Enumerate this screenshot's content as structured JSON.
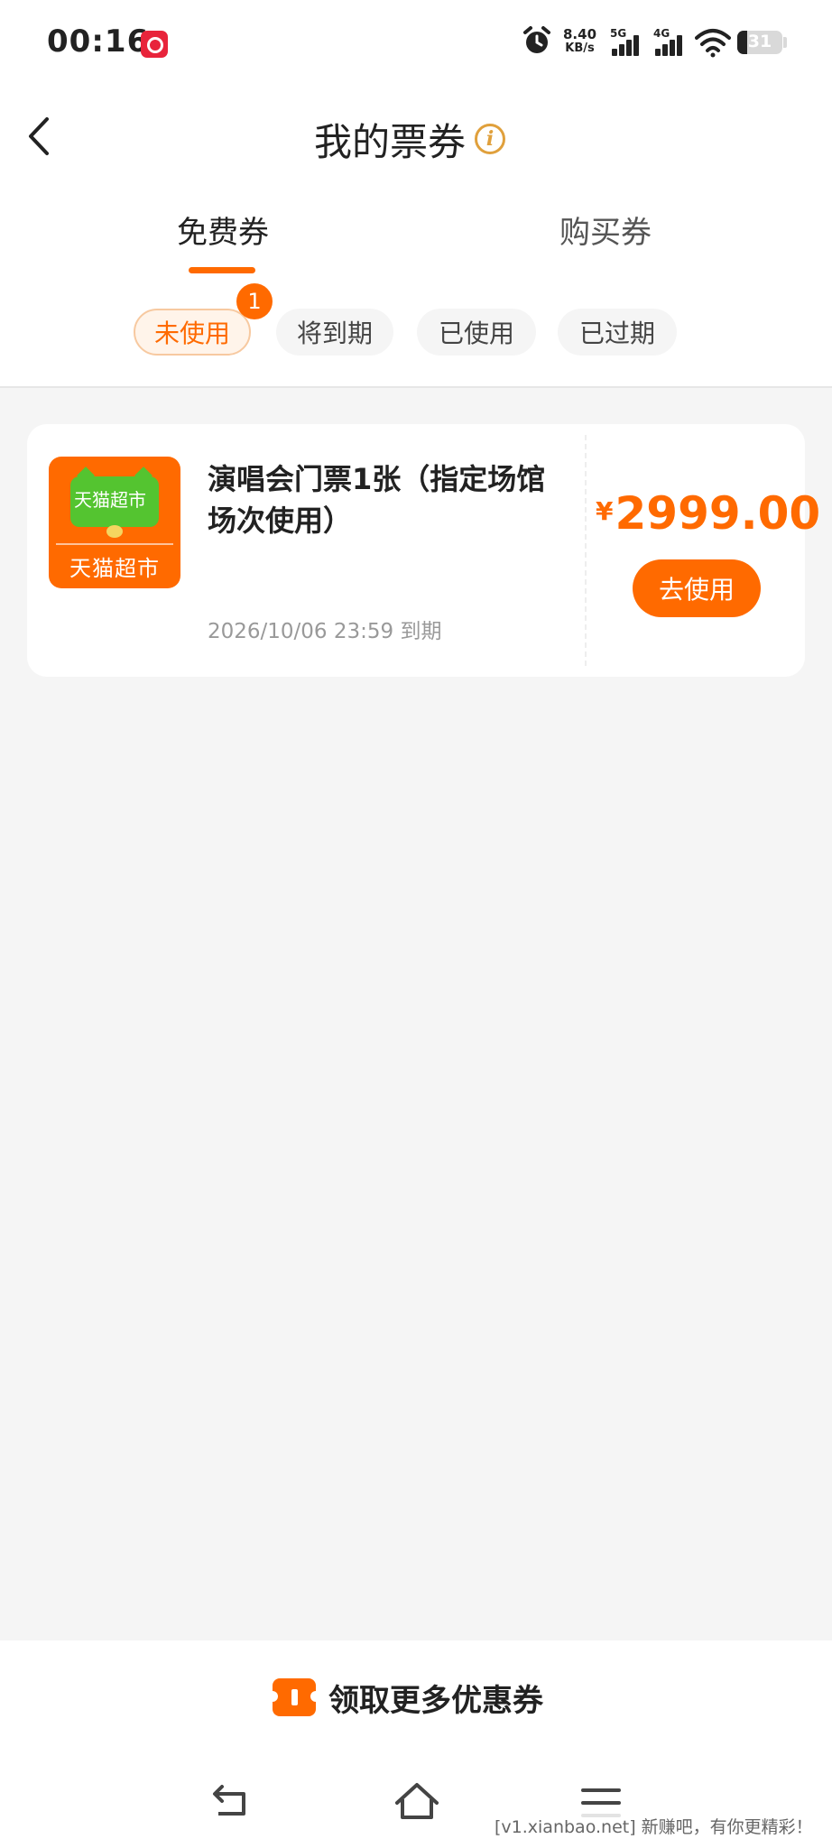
{
  "status_bar": {
    "time": "00:16",
    "speed_value": "8.40",
    "speed_unit": "KB/s",
    "net1": "5G",
    "net2": "4G",
    "battery": "31"
  },
  "header": {
    "title": "我的票券",
    "info_glyph": "i"
  },
  "tabs": [
    {
      "label": "免费券",
      "active": true
    },
    {
      "label": "购买券",
      "active": false
    }
  ],
  "filters": [
    {
      "label": "未使用",
      "active": true,
      "badge": "1"
    },
    {
      "label": "将到期",
      "active": false
    },
    {
      "label": "已使用",
      "active": false
    },
    {
      "label": "已过期",
      "active": false
    }
  ],
  "coupon": {
    "logo_top": "天猫超市",
    "logo_bottom": "天猫超市",
    "title": "演唱会门票1张（指定场馆场次使用）",
    "expiry": "2026/10/06 23:59 到期",
    "currency": "¥",
    "price": "2999.00",
    "button": "去使用"
  },
  "footer": {
    "more_coupons": "领取更多优惠券"
  },
  "watermark": "[v1.xianbao.net] 新赚吧，有你更精彩！",
  "colors": {
    "accent": "#ff6a00",
    "page_bg": "#f5f5f5",
    "logo_green": "#54c430"
  },
  "icons": [
    "back-arrow-icon",
    "info-icon",
    "alarm-icon",
    "wifi-icon",
    "battery-icon",
    "coupon-icon",
    "nav-back-icon",
    "nav-home-icon",
    "nav-menu-icon"
  ]
}
